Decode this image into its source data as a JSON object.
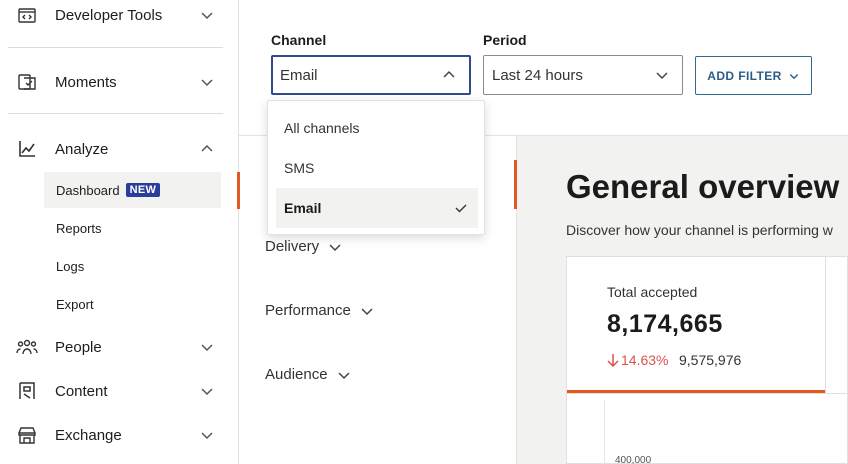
{
  "sidebar": {
    "items": [
      {
        "label": "Developer Tools",
        "icon": "code-icon"
      },
      {
        "label": "Moments",
        "icon": "moments-icon"
      },
      {
        "label": "Analyze",
        "icon": "chart-line-icon"
      },
      {
        "label": "People",
        "icon": "people-icon"
      },
      {
        "label": "Content",
        "icon": "content-icon"
      },
      {
        "label": "Exchange",
        "icon": "exchange-icon"
      }
    ],
    "analyze_sub": [
      {
        "label": "Dashboard",
        "badge": "NEW"
      },
      {
        "label": "Reports"
      },
      {
        "label": "Logs"
      },
      {
        "label": "Export"
      }
    ]
  },
  "filters": {
    "channel_label": "Channel",
    "channel_value": "Email",
    "period_label": "Period",
    "period_value": "Last 24 hours",
    "add_filter": "ADD FILTER"
  },
  "channel_dropdown": {
    "options": [
      "All channels",
      "SMS",
      "Email"
    ],
    "selected": "Email"
  },
  "sections": [
    "Delivery",
    "Performance",
    "Audience"
  ],
  "overview": {
    "title": "General overview",
    "subtitle": "Discover how your channel is performing w"
  },
  "card": {
    "label": "Total accepted",
    "value": "8,174,665",
    "change": "14.63%",
    "change_direction": "down",
    "previous": "9,575,976",
    "axis_tick": "400,000"
  },
  "colors": {
    "accent": "#e05a22",
    "focus_border": "#2f4b8a",
    "badge": "#2a3d9b",
    "negative": "#d9534f"
  }
}
